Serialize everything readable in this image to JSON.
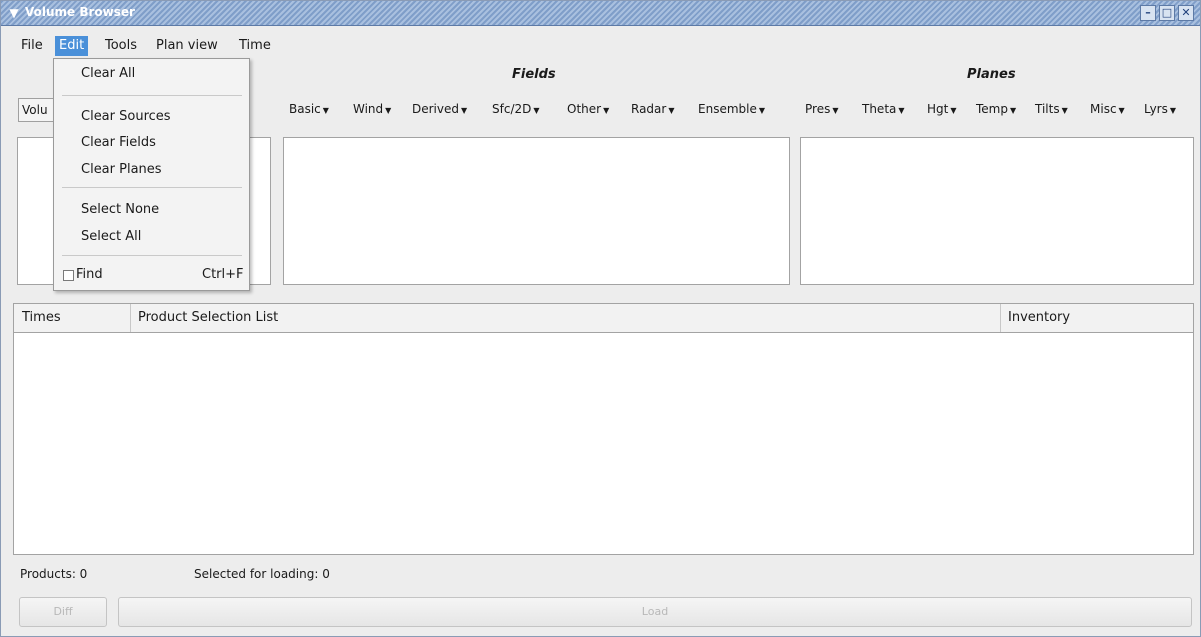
{
  "window": {
    "title": "Volume Browser"
  },
  "menubar": {
    "file": "File",
    "edit": "Edit",
    "tools": "Tools",
    "plan_view": "Plan view",
    "time": "Time"
  },
  "sections": {
    "volume_partial": "Volu",
    "fields": "Fields",
    "planes": "Planes"
  },
  "fields_menus": [
    "Basic",
    "Wind",
    "Derived",
    "Sfc/2D",
    "Other",
    "Radar",
    "Ensemble"
  ],
  "planes_menus": [
    "Pres",
    "Theta",
    "Hgt",
    "Temp",
    "Tilts",
    "Misc",
    "Lyrs"
  ],
  "edit_menu": {
    "clear_all": "Clear All",
    "clear_sources": "Clear Sources",
    "clear_fields": "Clear Fields",
    "clear_planes": "Clear Planes",
    "select_none": "Select None",
    "select_all": "Select All",
    "find": "Find",
    "find_accel": "Ctrl+F"
  },
  "table": {
    "times": "Times",
    "product_selection_list": "Product Selection List",
    "inventory": "Inventory"
  },
  "status": {
    "products": "Products:  0",
    "selected": "Selected for loading:  0"
  },
  "buttons": {
    "diff": "Diff",
    "load": "Load"
  },
  "colors": {
    "accent": "#4a90d9",
    "titlebar": "#7f9ec9"
  }
}
